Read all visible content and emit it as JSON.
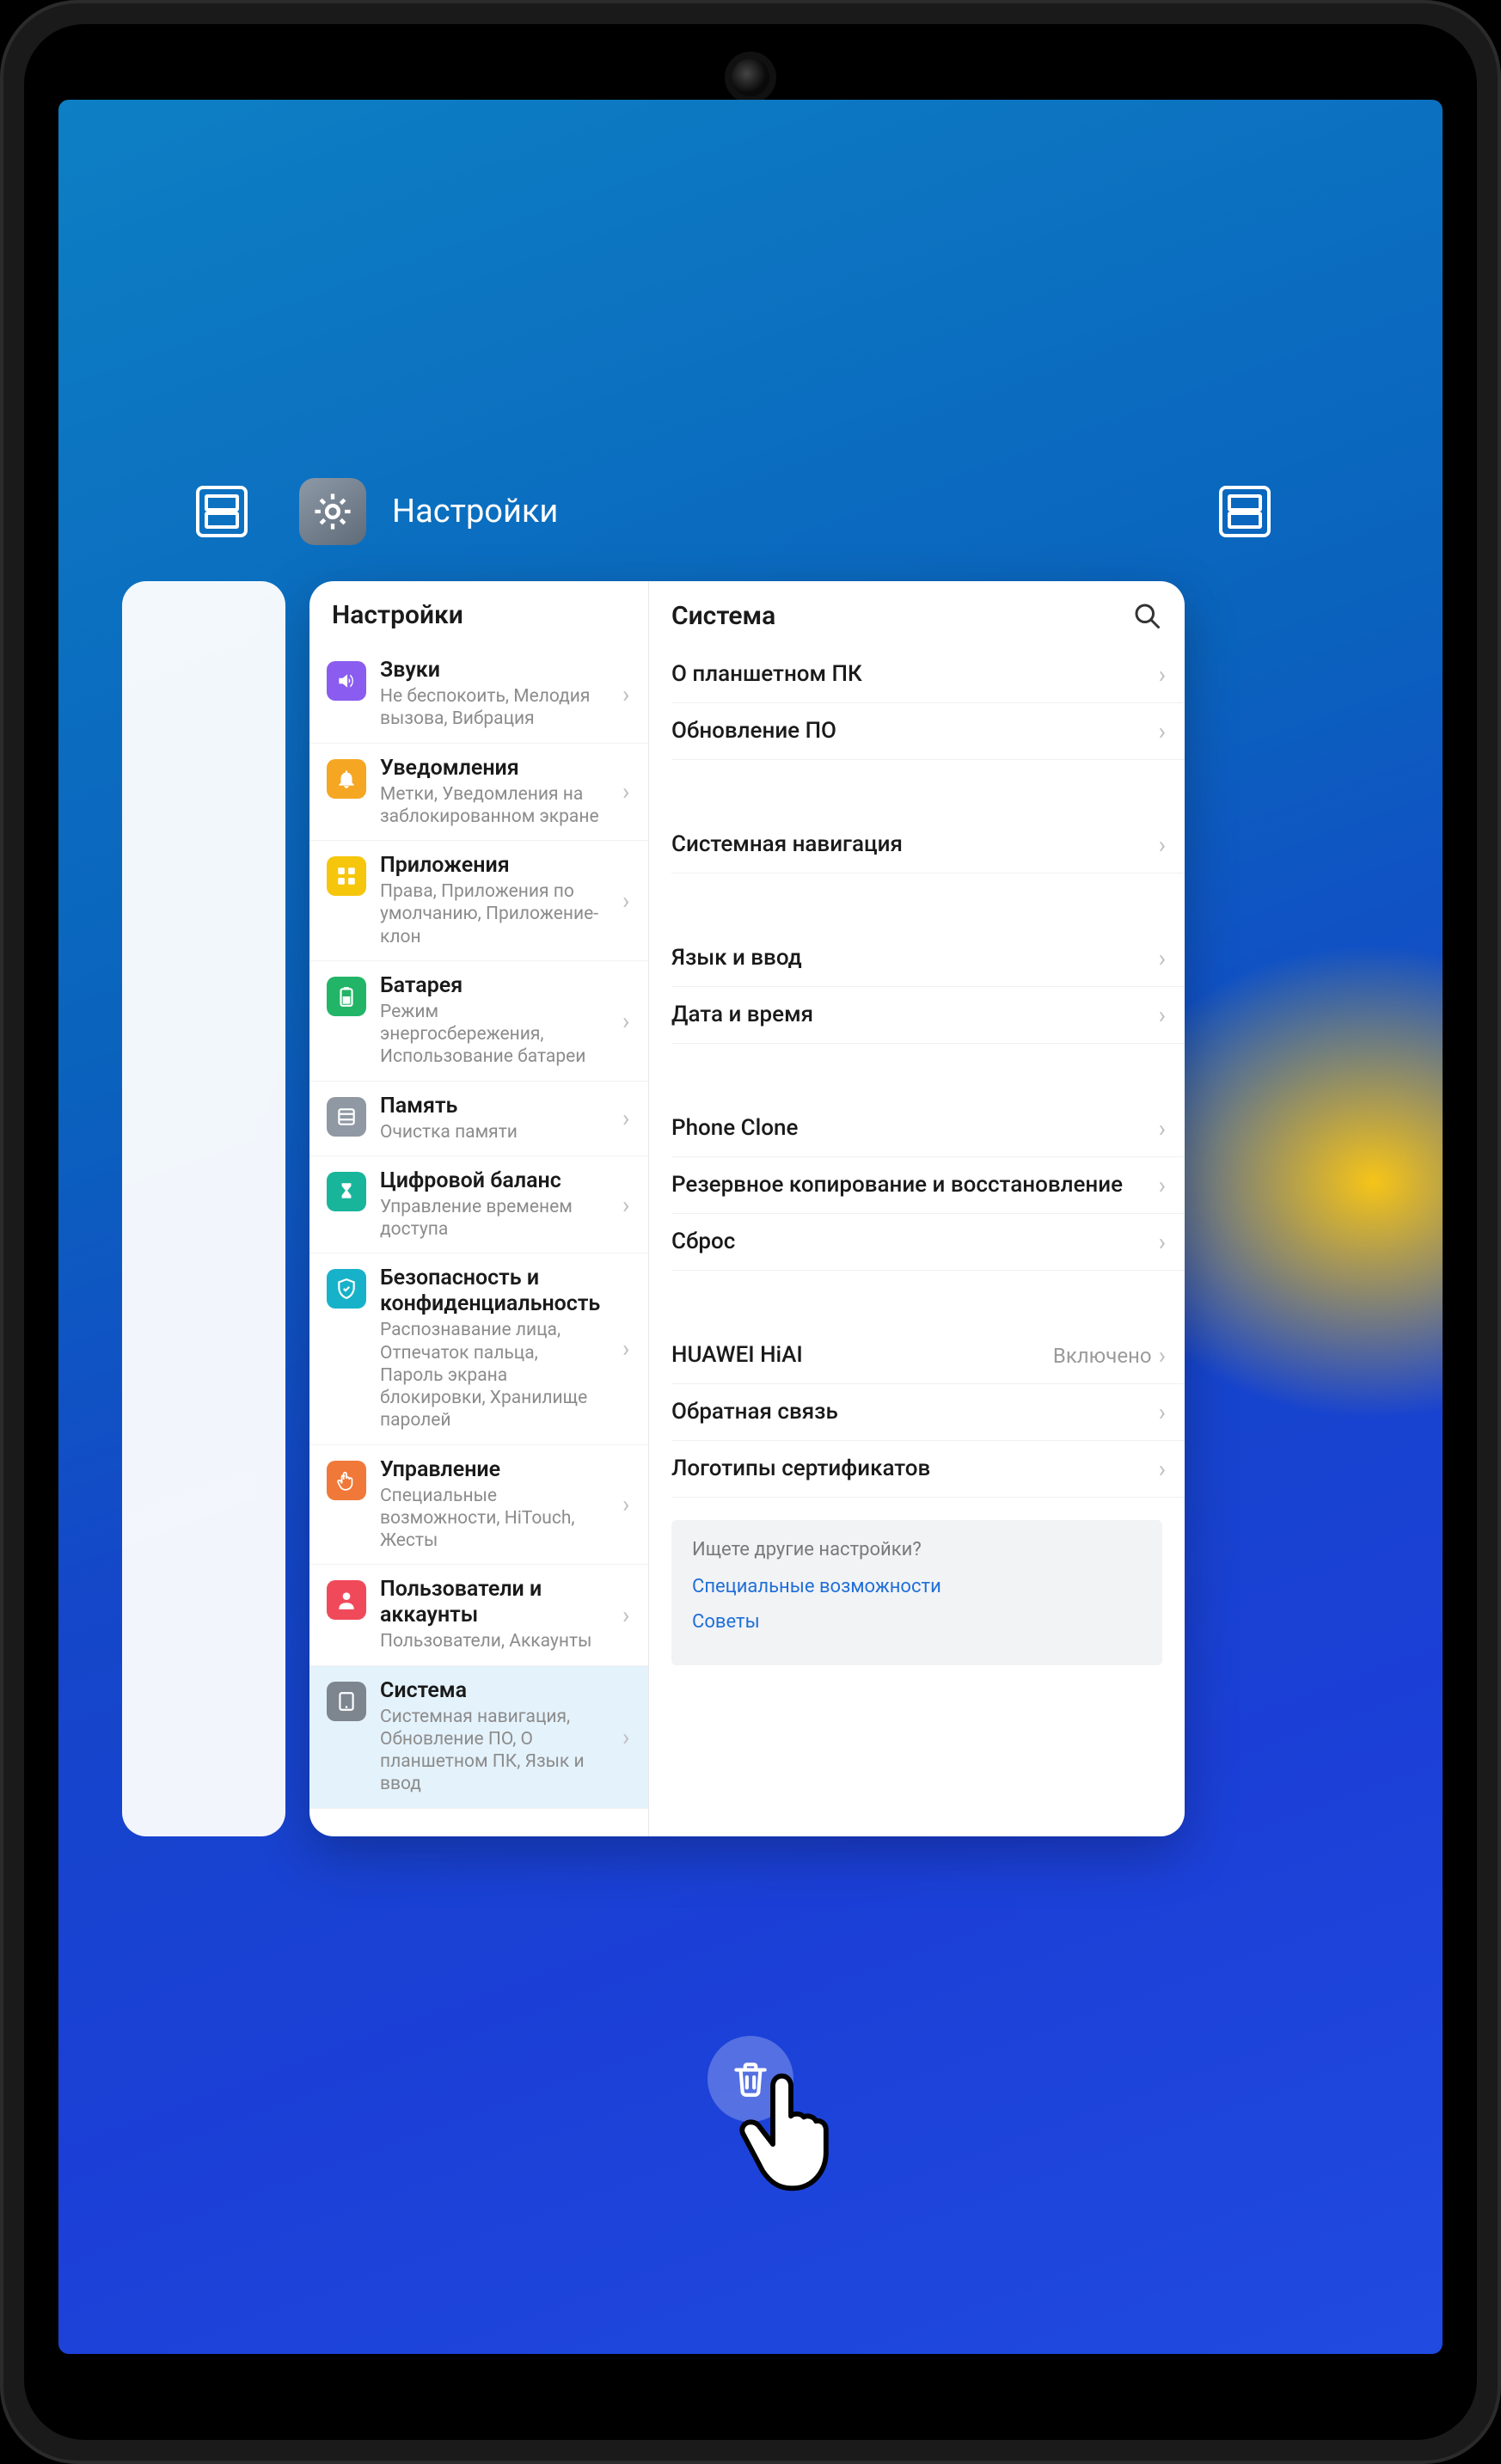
{
  "app": {
    "title": "Настройки"
  },
  "left": {
    "title": "Настройки",
    "items": [
      {
        "label": "Звуки",
        "sub": "Не беспокоить, Мелодия вызова, Вибрация",
        "icon": "sound-icon",
        "color": "ic-purple"
      },
      {
        "label": "Уведомления",
        "sub": "Метки, Уведомления на заблокированном экране",
        "icon": "bell-icon",
        "color": "ic-orange"
      },
      {
        "label": "Приложения",
        "sub": "Права, Приложения по умолчанию, Приложение-клон",
        "icon": "apps-icon",
        "color": "ic-yellow"
      },
      {
        "label": "Батарея",
        "sub": "Режим энергосбережения, Использование батареи",
        "icon": "battery-icon",
        "color": "ic-green"
      },
      {
        "label": "Память",
        "sub": "Очистка памяти",
        "icon": "storage-icon",
        "color": "ic-gray"
      },
      {
        "label": "Цифровой баланс",
        "sub": "Управление временем доступа",
        "icon": "hourglass-icon",
        "color": "ic-teal"
      },
      {
        "label": "Безопасность и конфиденциальность",
        "sub": "Распознавание лица, Отпечаток пальца, Пароль экрана блокировки, Хранилище паролей",
        "icon": "shield-icon",
        "color": "ic-cyan"
      },
      {
        "label": "Управление",
        "sub": "Специальные возможности, HiTouch, Жесты",
        "icon": "hand-icon",
        "color": "ic-ored"
      },
      {
        "label": "Пользователи и аккаунты",
        "sub": "Пользователи, Аккаунты",
        "icon": "user-icon",
        "color": "ic-red"
      },
      {
        "label": "Система",
        "sub": "Системная навигация, Обновление ПО, О планшетном ПК, Язык и ввод",
        "icon": "system-icon",
        "color": "ic-dgray",
        "active": true
      }
    ]
  },
  "right": {
    "title": "Система",
    "groups": [
      [
        {
          "label": "О планшетном ПК"
        },
        {
          "label": "Обновление ПО"
        }
      ],
      [
        {
          "label": "Системная навигация"
        }
      ],
      [
        {
          "label": "Язык и ввод"
        },
        {
          "label": "Дата и время"
        }
      ],
      [
        {
          "label": "Phone Clone"
        },
        {
          "label": "Резервное копирование и восстановление"
        },
        {
          "label": "Сброс"
        }
      ],
      [
        {
          "label": "HUAWEI HiAI",
          "value": "Включено"
        },
        {
          "label": "Обратная связь"
        },
        {
          "label": "Логотипы сертификатов"
        }
      ]
    ]
  },
  "hint": {
    "question": "Ищете другие настройки?",
    "links": [
      "Специальные возможности",
      "Советы"
    ]
  }
}
